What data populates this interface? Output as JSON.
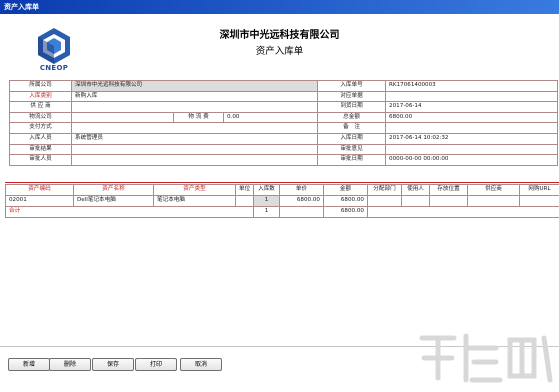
{
  "window": {
    "title": "资产入库单"
  },
  "header": {
    "logo_text": "CNEOP",
    "company": "深圳市中光远科技有限公司",
    "doc_title": "资产入库单"
  },
  "form": {
    "belong_company_label": "所属公司",
    "belong_company_value": "深圳市中光远科技有限公司",
    "category_label": "入库类别",
    "category_value": "新购入库",
    "supplier_label": "供 应 商",
    "supplier_value": "",
    "logistics_label": "物流公司",
    "logistics_value": "",
    "logistics_fee_label": "物 流 费",
    "logistics_fee_value": "0.00",
    "pay_method_label": "支付方式",
    "pay_method_value": "",
    "staff_label": "入库人员",
    "staff_value": "系统管理员",
    "audit_result_label": "审批结果",
    "audit_result_value": "",
    "approver_label": "审批人员",
    "approver_value": "",
    "order_no_label": "入库单号",
    "order_no_value": "RK17061400003",
    "source_label": "对应单据",
    "source_value": "",
    "arrival_label": "到货日期",
    "arrival_value": "2017-06-14",
    "total_label": "总金额",
    "total_value": "6800.00",
    "remark_label": "备　注",
    "remark_value": "",
    "in_date_label": "入库日期",
    "in_date_value": "2017-06-14 10:02:32",
    "audit_opinion_label": "审批意见",
    "audit_opinion_value": "",
    "audit_date_label": "审批日期",
    "audit_date_value": "0000-00-00 00:00:00"
  },
  "grid": {
    "headers": [
      "资产编码",
      "资产名称",
      "资产类型",
      "单位",
      "入库数",
      "单价",
      "金额",
      "分配部门",
      "使用人",
      "存放位置",
      "供应商",
      "网购URL"
    ],
    "rows": [
      [
        "02001",
        "Dell笔记本电脑",
        "笔记本电脑",
        "",
        "1",
        "6800.00",
        "6800.00",
        "",
        "",
        "",
        "",
        ""
      ]
    ],
    "total_label": "合计",
    "total_qty": "1",
    "total_amount": "6800.00"
  },
  "buttons": {
    "add": "新增",
    "delete": "删除",
    "save": "保存",
    "print": "打印",
    "cancel": "取消"
  },
  "colors": {
    "titlebar": "#0a3bb0",
    "required": "#c42020",
    "border": "#b08a8a"
  }
}
